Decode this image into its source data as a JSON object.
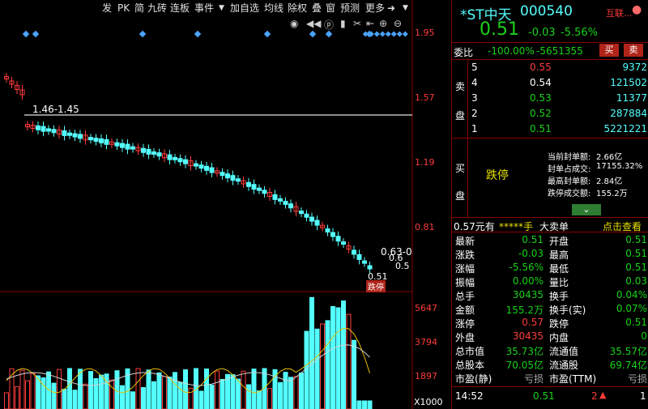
{
  "toolbar": {
    "items": [
      "发",
      "PK",
      "简",
      "九砖",
      "连板",
      "事件",
      "加自选",
      "均线",
      "除权",
      "叠",
      "窗",
      "预测",
      "更多"
    ]
  },
  "chart": {
    "price_ticks": [
      "1.95",
      "1.57",
      "1.19",
      "0.81"
    ],
    "volume_ticks": [
      "5647",
      "3794",
      "1897"
    ],
    "volume_unit": "X1000",
    "range_label": "1.46-1.45",
    "side_labels": [
      "0.63-0",
      "0.6",
      "0.5"
    ],
    "low_label": "0.51",
    "limit_tag": "跌停"
  },
  "header": {
    "name": "*ST中天",
    "code": "000540",
    "link": "互联...",
    "price": "0.51",
    "change": "-0.03",
    "change_pct": "-5.56%"
  },
  "weibi": {
    "label": "委比",
    "value": "-100.00%",
    "diff": "-5651355",
    "buy": "买",
    "sell": "卖"
  },
  "sell_book": {
    "side_label": [
      "卖",
      "盘"
    ],
    "rows": [
      {
        "level": "5",
        "price": "0.55",
        "vol": "9372"
      },
      {
        "level": "4",
        "price": "0.54",
        "vol": "121502"
      },
      {
        "level": "3",
        "price": "0.53",
        "vol": "11377"
      },
      {
        "level": "2",
        "price": "0.52",
        "vol": "287884"
      },
      {
        "level": "1",
        "price": "0.51",
        "vol": "5221221"
      }
    ]
  },
  "buy_book": {
    "side_label": [
      "买",
      "盘"
    ],
    "state": "跌停",
    "stats": [
      {
        "k": "当前封单额:",
        "v": "2.66亿"
      },
      {
        "k": "封单占成交:",
        "v": "17155.32%"
      },
      {
        "k": "最高封单额:",
        "v": "2.84亿"
      },
      {
        "k": "跌停成交额:",
        "v": "155.2万"
      }
    ]
  },
  "big_order": {
    "price": "0.57元有",
    "stars": "*****手",
    "title": "大卖单",
    "action": "点击查看"
  },
  "stats": [
    {
      "l": "最新",
      "lv": "0.51",
      "lc": "green",
      "r": "开盘",
      "rv": "0.51",
      "rc": "green"
    },
    {
      "l": "涨跌",
      "lv": "-0.03",
      "lc": "green",
      "r": "最高",
      "rv": "0.51",
      "rc": "green"
    },
    {
      "l": "涨幅",
      "lv": "-5.56%",
      "lc": "green",
      "r": "最低",
      "rv": "0.51",
      "rc": "green"
    },
    {
      "l": "振幅",
      "lv": "0.00%",
      "lc": "green",
      "r": "量比",
      "rv": "0.03",
      "rc": "green"
    },
    {
      "l": "总手",
      "lv": "30435",
      "lc": "green",
      "r": "换手",
      "rv": "0.04%",
      "rc": "green"
    },
    {
      "l": "金额",
      "lv": "155.2万",
      "lc": "green",
      "r": "换手(实)",
      "rv": "0.07%",
      "rc": "green"
    },
    {
      "l": "涨停",
      "lv": "0.57",
      "lc": "red",
      "r": "跌停",
      "rv": "0.51",
      "rc": "green"
    },
    {
      "l": "外盘",
      "lv": "30435",
      "lc": "red",
      "r": "内盘",
      "rv": "0",
      "rc": "green"
    },
    {
      "l": "总市值",
      "lv": "35.73亿",
      "lc": "green",
      "r": "流通值",
      "rv": "35.57亿",
      "rc": "green"
    },
    {
      "l": "总股本",
      "lv": "70.05亿",
      "lc": "green",
      "r": "流通股",
      "rv": "69.74亿",
      "rc": "green"
    },
    {
      "l": "市盈(静)",
      "lv": "亏损",
      "lc": "gray",
      "r": "市盈(TTM)",
      "rv": "亏损",
      "rc": "gray"
    }
  ],
  "tick": {
    "time": "14:52",
    "price": "0.51",
    "vol": "2",
    "flag": "1"
  },
  "colors": {
    "up": "#ff3b3b",
    "down": "#19d219",
    "cyan": "#54ffff",
    "panel_border": "#8b0000"
  }
}
